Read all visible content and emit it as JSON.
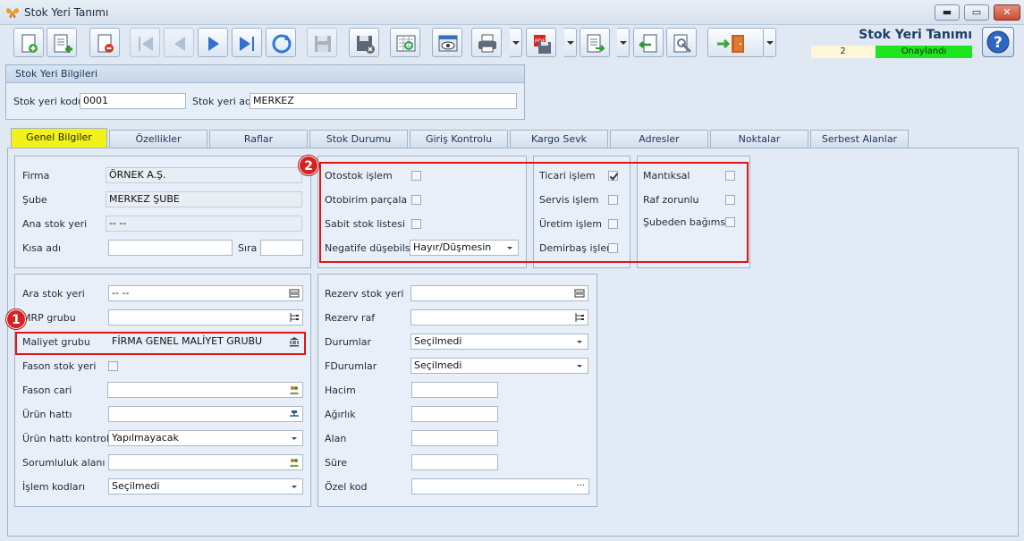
{
  "window": {
    "title": "Stok Yeri Tanımı"
  },
  "header": {
    "title": "Stok Yeri Tanımı",
    "record_number": "2",
    "status": "Onaylandı"
  },
  "colors": {
    "active_tab": "#f2f21a",
    "status_ok": "#1ee51e",
    "highlight": "#e01515"
  },
  "toolbar": {
    "icons": [
      "new-record-icon",
      "add-record-icon",
      "delete-record-icon",
      "first-record-icon",
      "previous-record-icon",
      "next-record-icon",
      "last-record-icon",
      "refresh-icon",
      "save-icon",
      "save-cancel-icon",
      "preview-icon",
      "view-icon",
      "print-icon",
      "pdf-export-icon",
      "export-icon",
      "import-icon",
      "tools-icon",
      "exit-icon",
      "help-icon"
    ]
  },
  "stok_yeri_bilgileri": {
    "title": "Stok Yeri Bilgileri",
    "kod_label": "Stok yeri kodu",
    "kod_value": "0001",
    "ad_label": "Stok yeri adı",
    "ad_value": "MERKEZ"
  },
  "tabs": [
    {
      "label": "Genel Bilgiler",
      "active": true
    },
    {
      "label": "Özellikler"
    },
    {
      "label": "Raflar"
    },
    {
      "label": "Stok Durumu"
    },
    {
      "label": "Giriş Kontrolu"
    },
    {
      "label": "Kargo Sevk"
    },
    {
      "label": "Adresler"
    },
    {
      "label": "Noktalar"
    },
    {
      "label": "Serbest Alanlar"
    }
  ],
  "general": {
    "firma_label": "Firma",
    "firma_value": "ÖRNEK A.Ş.",
    "sube_label": "Şube",
    "sube_value": "MERKEZ ŞUBE",
    "ana_label": "Ana stok yeri",
    "ana_value": "-- --",
    "kisa_label": "Kısa adı",
    "kisa_value": "",
    "sira_label": "Sıra",
    "sira_value": ""
  },
  "flags1": {
    "otostok": "Otostok işlem",
    "otobirim": "Otobirim parçala",
    "sabit": "Sabit stok listesi",
    "negatif_label": "Negatife düşebilsin",
    "negatif_value": "Hayır/Düşmesin"
  },
  "flags2": {
    "ticari": "Ticari işlem",
    "servis": "Servis işlem",
    "uretim": "Üretim işlem",
    "demirbas": "Demirbaş işlem"
  },
  "flags3": {
    "mantiksal": "Mantıksal",
    "raf": "Raf zorunlu",
    "sube": "Şubeden bağımsız"
  },
  "left_details": {
    "ara_label": "Ara stok yeri",
    "ara_value": "-- --",
    "mrp_label": "MRP grubu",
    "mrp_value": "",
    "maliyet_label": "Maliyet grubu",
    "maliyet_value": "FİRMA GENEL MALİYET GRUBU",
    "fason_stok_label": "Fason stok yeri",
    "fason_cari_label": "Fason cari",
    "fason_cari_value": "",
    "urun_hatti_label": "Ürün hattı",
    "urun_hatti_value": "",
    "urun_kontrol_label": "Ürün hattı kontrolü",
    "urun_kontrol_value": "Yapılmayacak",
    "sorumluluk_label": "Sorumluluk alanı",
    "sorumluluk_value": "",
    "islem_label": "İşlem kodları",
    "islem_value": "Seçilmedi"
  },
  "right_details": {
    "rezerv_label": "Rezerv stok yeri",
    "rezerv_value": "",
    "rezerv_raf_label": "Rezerv raf",
    "rezerv_raf_value": "",
    "durumlar_label": "Durumlar",
    "durumlar_value": "Seçilmedi",
    "fdurumlar_label": "FDurumlar",
    "fdurumlar_value": "Seçilmedi",
    "hacim_label": "Hacim",
    "hacim_value": "",
    "agirlik_label": "Ağırlık",
    "agirlik_value": "",
    "alan_label": "Alan",
    "alan_value": "",
    "sure_label": "Süre",
    "sure_value": "",
    "ozel_label": "Özel kod",
    "ozel_value": ""
  },
  "badges": {
    "one": "1",
    "two": "2"
  }
}
